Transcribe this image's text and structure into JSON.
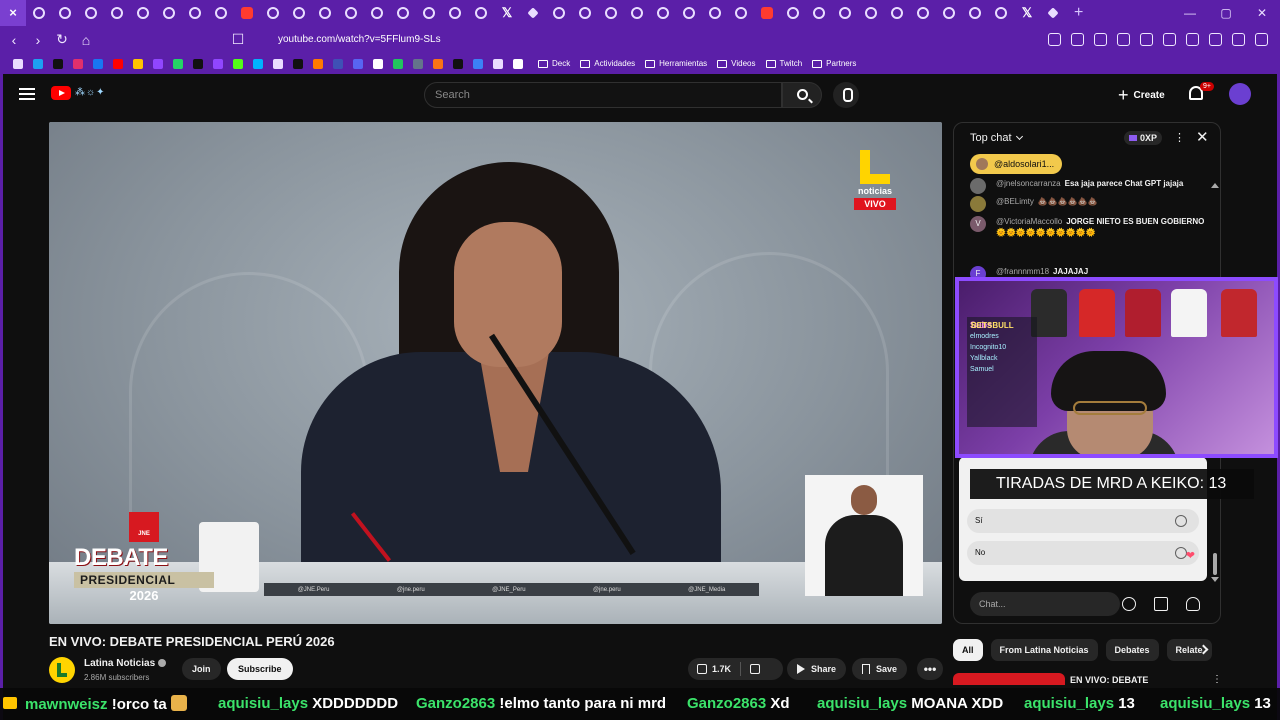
{
  "browser": {
    "tab_count": 43,
    "url": "youtube.com/watch?v=5FFlum9-SLs",
    "bookmarks": [
      "Deck",
      "Actividades",
      "Herramientas",
      "Videos",
      "Twitch",
      "Partners"
    ]
  },
  "yt_header": {
    "search_placeholder": "Search",
    "create_label": "Create",
    "notif_badge": "9+"
  },
  "player": {
    "brand_word": "noticias",
    "live_label": "VIVO",
    "jne_label": "JNE",
    "debate_word": "DEBATE",
    "presidencial_word": "PRESIDENCIAL",
    "year": "2026",
    "socials": [
      "@JNE.Peru",
      "@jne.peru",
      "@JNE_Peru",
      "@jne.peru",
      "@JNE_Media"
    ]
  },
  "video": {
    "title": "EN VIVO: DEBATE PRESIDENCIAL PERÚ 2026",
    "channel": "Latina Noticias",
    "subscribers": "2.86M subscribers",
    "join_label": "Join",
    "subscribe_label": "Subscribe",
    "likes": "1.7K",
    "share_label": "Share",
    "save_label": "Save",
    "more_label": "•••"
  },
  "chat": {
    "title": "Top chat",
    "xp": "0XP",
    "pinned_user": "@aldosolari1...",
    "messages": [
      {
        "author": "@jnelsoncarranza",
        "text": "Esa jaja parece Chat GPT jajaja",
        "color": "#6b6b6b"
      },
      {
        "author": "@BELimty",
        "text": "💩💩💩💩💩💩",
        "color": "#8a7a3a"
      },
      {
        "author": "@VictoriaMaccollo",
        "text": "JORGE NIETO ES BUEN GOBIERNO 🌞🌞🌞🌞🌞🌞🌞🌞🌞🌞",
        "color": "#7a5a6b",
        "letter": "V"
      },
      {
        "author": "@frannnmm18",
        "text": "JAJAJAJ",
        "color": "#6a3fd1",
        "letter": "F"
      }
    ],
    "poll_options": [
      "Sí",
      "No"
    ],
    "input_placeholder": "Chat..."
  },
  "stream_overlay": {
    "brand_tag": "BETSBULL",
    "subs_header": "Subs",
    "subs_list": [
      "elmodres",
      "Incognito10",
      "Yallblack",
      "Samuel"
    ],
    "counter_text": "TIRADAS DE MRD A KEIKO: 13"
  },
  "related": {
    "chips": [
      "All",
      "From Latina Noticias",
      "Debates",
      "Relate"
    ],
    "first_title": "EN VIVO: DEBATE"
  },
  "ticker": [
    {
      "user": "mawnweisz",
      "msg": "!orco ta",
      "emote": true
    },
    {
      "user": "aquisiu_lays",
      "msg": "XDDDDDDD"
    },
    {
      "user": "Ganzo2863",
      "msg": "!elmo tanto para ni mrd"
    },
    {
      "user": "Ganzo2863",
      "msg": "Xd"
    },
    {
      "user": "aquisiu_lays",
      "msg": "MOANA XDD"
    },
    {
      "user": "aquisiu_lays",
      "msg": "13"
    },
    {
      "user": "aquisiu_lays",
      "msg": "13"
    }
  ]
}
